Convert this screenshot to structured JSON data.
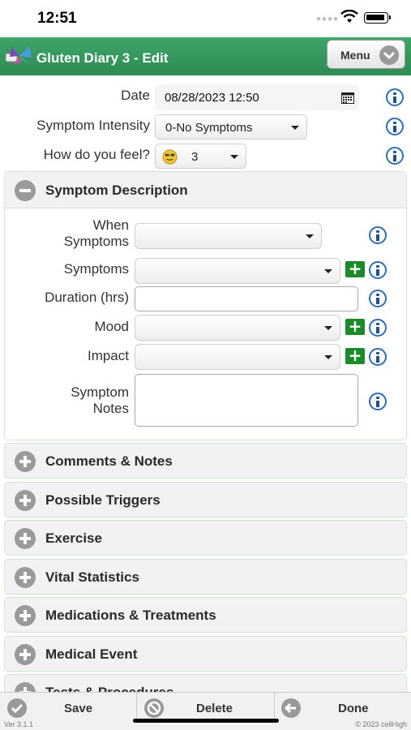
{
  "status_bar": {
    "time": "12:51"
  },
  "header": {
    "title": "Gluten Diary 3 - Edit",
    "menu_label": "Menu"
  },
  "entry": {
    "date_label": "Date",
    "date_value": "08/28/2023 12:50",
    "intensity_label": "Symptom Intensity",
    "intensity_value": "0-No Symptoms",
    "feel_label": "How do you feel?",
    "feel_value": "3"
  },
  "symptom_section": {
    "title": "Symptom Description",
    "when_label_1": "When",
    "when_label_2": "Symptoms",
    "when_value": "",
    "symptoms_label": "Symptoms",
    "symptoms_value": "",
    "duration_label": "Duration (hrs)",
    "duration_value": "",
    "mood_label": "Mood",
    "mood_value": "",
    "impact_label": "Impact",
    "impact_value": "",
    "notes_label_1": "Symptom",
    "notes_label_2": "Notes",
    "notes_value": ""
  },
  "sections": [
    {
      "title": "Comments & Notes"
    },
    {
      "title": "Possible Triggers"
    },
    {
      "title": "Exercise"
    },
    {
      "title": "Vital Statistics"
    },
    {
      "title": "Medications & Treatments"
    },
    {
      "title": "Medical Event"
    },
    {
      "title": "Tests & Procedures"
    }
  ],
  "footer": {
    "save_label": "Save",
    "delete_label": "Delete",
    "done_label": "Done",
    "version": "Ver 3.1.1",
    "copyright": "© 2023 cellHigh"
  },
  "colors": {
    "header_green": "#2d8a52",
    "info_blue": "#2e6db5",
    "plus_green": "#1a8a2a"
  }
}
